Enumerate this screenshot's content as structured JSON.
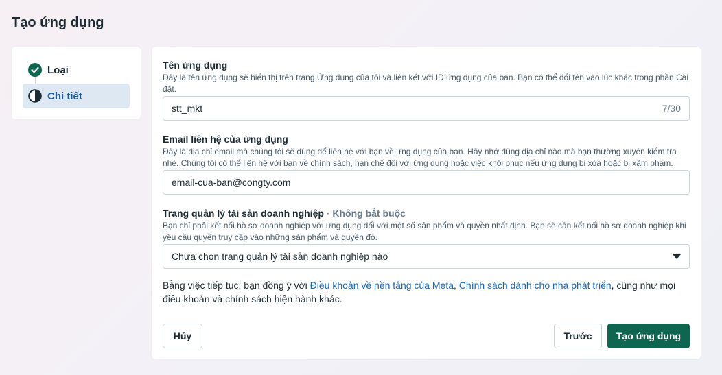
{
  "page": {
    "title": "Tạo ứng dụng"
  },
  "steps": [
    {
      "label": "Loại",
      "state": "done"
    },
    {
      "label": "Chi tiết",
      "state": "active"
    }
  ],
  "form": {
    "app_name": {
      "label": "Tên ứng dụng",
      "description": "Đây là tên ứng dụng sẽ hiển thị trên trang Ứng dụng của tôi và liên kết với ID ứng dụng của bạn. Bạn có thể đổi tên vào lúc khác trong phần Cài đặt.",
      "value": "stt_mkt",
      "counter": "7/30"
    },
    "contact_email": {
      "label": "Email liên hệ của ứng dụng",
      "description": "Đây là địa chỉ email mà chúng tôi sẽ dùng để liên hệ với bạn về ứng dụng của bạn. Hãy nhớ dùng địa chỉ nào mà bạn thường xuyên kiểm tra nhé. Chúng tôi có thể liên hệ với bạn về chính sách, hạn chế đối với ứng dụng hoặc việc khôi phục nếu ứng dụng bị xóa hoặc bị xâm phạm.",
      "value": "email-cua-ban@congty.com"
    },
    "business_portfolio": {
      "label": "Trang quản lý tài sản doanh nghiệp",
      "optional": " · Không bắt buộc",
      "description": "Bạn chỉ phải kết nối hồ sơ doanh nghiệp với ứng dụng đối với một số sản phẩm và quyền nhất định. Bạn sẽ cần kết nối hồ sơ doanh nghiệp khi yêu cầu quyền truy cập vào những sản phẩm và quyền đó.",
      "selected": "Chưa chọn trang quản lý tài sản doanh nghiệp nào"
    }
  },
  "terms": {
    "prefix": "Bằng việc tiếp tục, bạn đồng ý với ",
    "link1": "Điều khoản về nền tảng của Meta",
    "sep": ", ",
    "link2": "Chính sách dành cho nhà phát triển",
    "suffix": ", cũng như mọi điều khoản và chính sách hiện hành khác."
  },
  "buttons": {
    "cancel": "Hủy",
    "previous": "Trước",
    "create": "Tạo ứng dụng"
  },
  "colors": {
    "primary": "#0e6650",
    "active_step_bg": "#dde8f3",
    "link": "#1a66b3"
  }
}
